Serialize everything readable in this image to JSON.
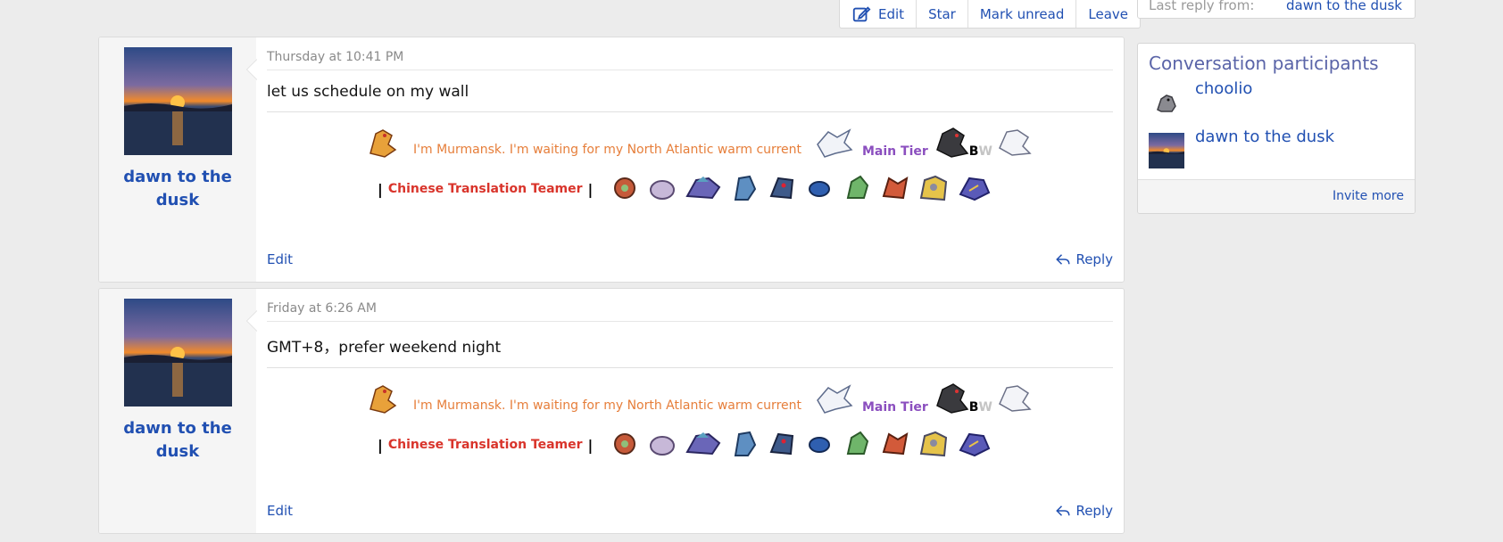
{
  "toolbar": {
    "edit": "Edit",
    "star": "Star",
    "mark_unread": "Mark unread",
    "leave": "Leave"
  },
  "side_info": {
    "last_reply_label": "Last reply from:",
    "last_reply_user": "dawn to the dusk"
  },
  "participants": {
    "title": "Conversation participants",
    "users": [
      "choolio",
      "dawn to the dusk"
    ],
    "invite": "Invite more"
  },
  "messages": [
    {
      "author": "dawn to the dusk",
      "date": "Thursday at 10:41 PM",
      "body": "let us schedule on my wall",
      "edit": "Edit",
      "reply": "Reply"
    },
    {
      "author": "dawn to the dusk",
      "date": "Friday at 6:26 AM",
      "body": "GMT+8，prefer weekend night",
      "edit": "Edit",
      "reply": "Reply"
    }
  ],
  "signature": {
    "line1": "I'm Murmansk. I'm waiting for my North Atlantic warm current",
    "tier": "Main Tier",
    "bw_b": "B",
    "bw_w": "W",
    "bar": "|",
    "teamer": "Chinese Translation Teamer"
  },
  "colors": {
    "link": "#2150b2",
    "sig_orange": "#e67e3a",
    "sig_purple": "#8b4fbf",
    "sig_red": "#d9342b"
  }
}
